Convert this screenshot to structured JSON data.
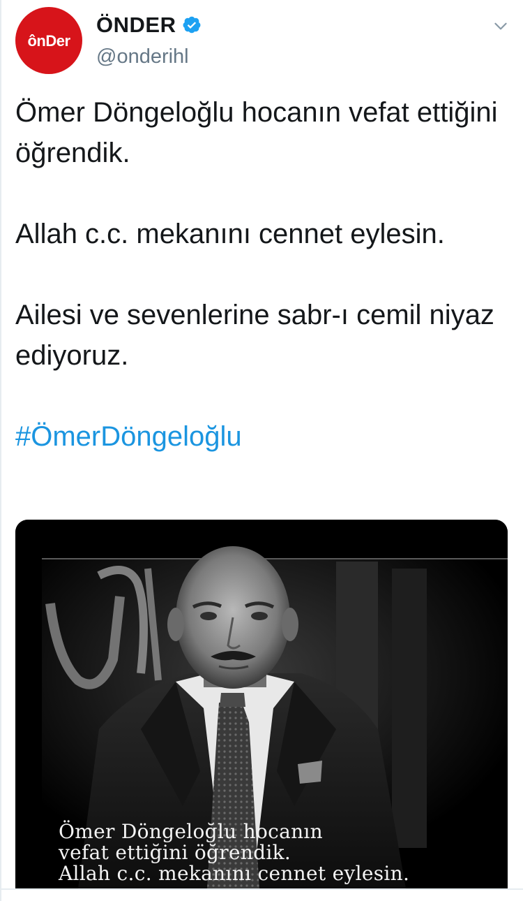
{
  "tweet": {
    "author": {
      "name": "ÖNDER",
      "handle": "@onderihl",
      "avatar_text": "ônDer",
      "verified": true
    },
    "paragraphs": [
      "Ömer Döngeloğlu hocanın vefat ettiğini öğrendik.",
      "Allah c.c. mekanını cennet eylesin.",
      "Ailesi ve sevenlerine sabr-ı cemil niyaz ediyoruz."
    ],
    "hashtag": "#ÖmerDöngeloğlu",
    "image": {
      "caption_lines": [
        "Ömer Döngeloğlu hocanın",
        "vefat ettiğini öğrendik.",
        "Allah c.c. mekanını cennet eylesin."
      ]
    }
  },
  "colors": {
    "brand_red": "#d7141a",
    "verified_blue": "#1da1f2",
    "link_blue": "#1b95e0",
    "text": "#14171a",
    "secondary_text": "#657786"
  },
  "icons": {
    "verified": "verified-badge-icon",
    "more": "chevron-down-icon"
  }
}
